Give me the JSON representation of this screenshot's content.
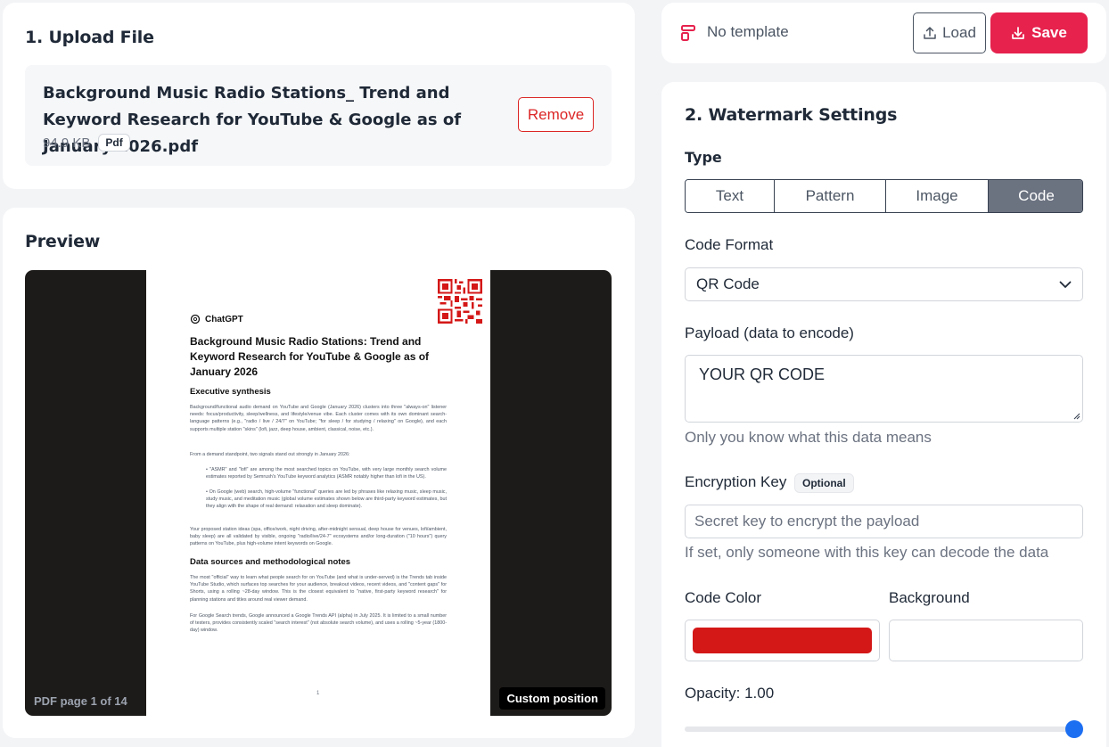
{
  "upload": {
    "title": "1. Upload File",
    "file_name": "Background Music Radio Stations_ Trend and Keyword Research for YouTube & Google as of January 2026.pdf",
    "file_size": "94.9 KB",
    "file_type": "Pdf",
    "remove_label": "Remove"
  },
  "preview": {
    "title": "Preview",
    "page_label": "PDF page 1 of 14",
    "custom_position_label": "Custom position",
    "page": {
      "logo_text": "ChatGPT",
      "title": "Background Music Radio Stations: Trend and Keyword Research for YouTube & Google as of January 2026",
      "section1": "Executive synthesis",
      "p1": "Background/functional audio demand on YouTube and Google (January 2026) clusters into three \"always-on\" listener needs: focus/productivity, sleep/wellness, and lifestyle/venue vibe. Each cluster comes with its own dominant search-language patterns (e.g., \"radio / live / 24/7\" on YouTube; \"for sleep / for studying / relaxing\" on Google), and each supports multiple station \"skins\" (lofi, jazz, deep house, ambient, classical, noise, etc.).",
      "p2": "From a demand standpoint, two signals stand out strongly in January 2026:",
      "b1": "• \"ASMR\" and \"lofi\" are among the most searched topics on YouTube, with very large monthly search volume estimates reported by Semrush's YouTube keyword analytics (ASMR notably higher than lofi in the US).",
      "b2": "• On Google (web) search, high-volume \"functional\" queries are led by phrases like relaxing music, sleep music, study music, and meditation music (global volume estimates shown below are third-party keyword estimates, but they align with the shape of real demand: relaxation and sleep dominate).",
      "p3": "Your proposed station ideas (spa, office/work, night driving, after-midnight sensual, deep house for venues, lofi/ambient, baby sleep) are all validated by visible, ongoing \"radio/live/24-7\" ecosystems and/or long-duration (\"10 hours\") query patterns on YouTube, plus high-volume intent keywords on Google.",
      "section2": "Data sources and methodological notes",
      "p4": "The most \"official\" way to learn what people search for on YouTube (and what is under-served) is the Trends tab inside YouTube Studio, which surfaces top searches for your audience, breakout videos, recent videos, and \"content gaps\" for Shorts, using a rolling ~28-day window. This is the closest equivalent to \"native, first-party keyword research\" for planning stations and titles around real viewer demand.",
      "p5": "For Google Search trends, Google announced a Google Trends API (alpha) in July 2025. It is limited to a small number of testers, provides consistently scaled \"search interest\" (not absolute search volume), and uses a rolling ~5-year (1800-day) window.",
      "page_number": "1"
    }
  },
  "template": {
    "label": "No template",
    "load_label": "Load",
    "save_label": "Save"
  },
  "settings": {
    "title": "2. Watermark Settings",
    "type_label": "Type",
    "types": [
      "Text",
      "Pattern",
      "Image",
      "Code"
    ],
    "active_type": "Code",
    "code_format_label": "Code Format",
    "code_format_value": "QR Code",
    "payload_label": "Payload (data to encode)",
    "payload_value": "YOUR QR CODE",
    "payload_help": "Only you know what this data means",
    "encryption_label": "Encryption Key",
    "optional_label": "Optional",
    "encryption_placeholder": "Secret key to encrypt the payload",
    "encryption_help": "If set, only someone with this key can decode the data",
    "code_color_label": "Code Color",
    "code_color": "#d41717",
    "background_label": "Background",
    "background_color": "#ffffff",
    "opacity_label": "Opacity: 1.00",
    "opacity": 1.0
  },
  "colors": {
    "accent": "#e6224d",
    "danger": "#dc2626",
    "slider": "#1d6ff2"
  }
}
